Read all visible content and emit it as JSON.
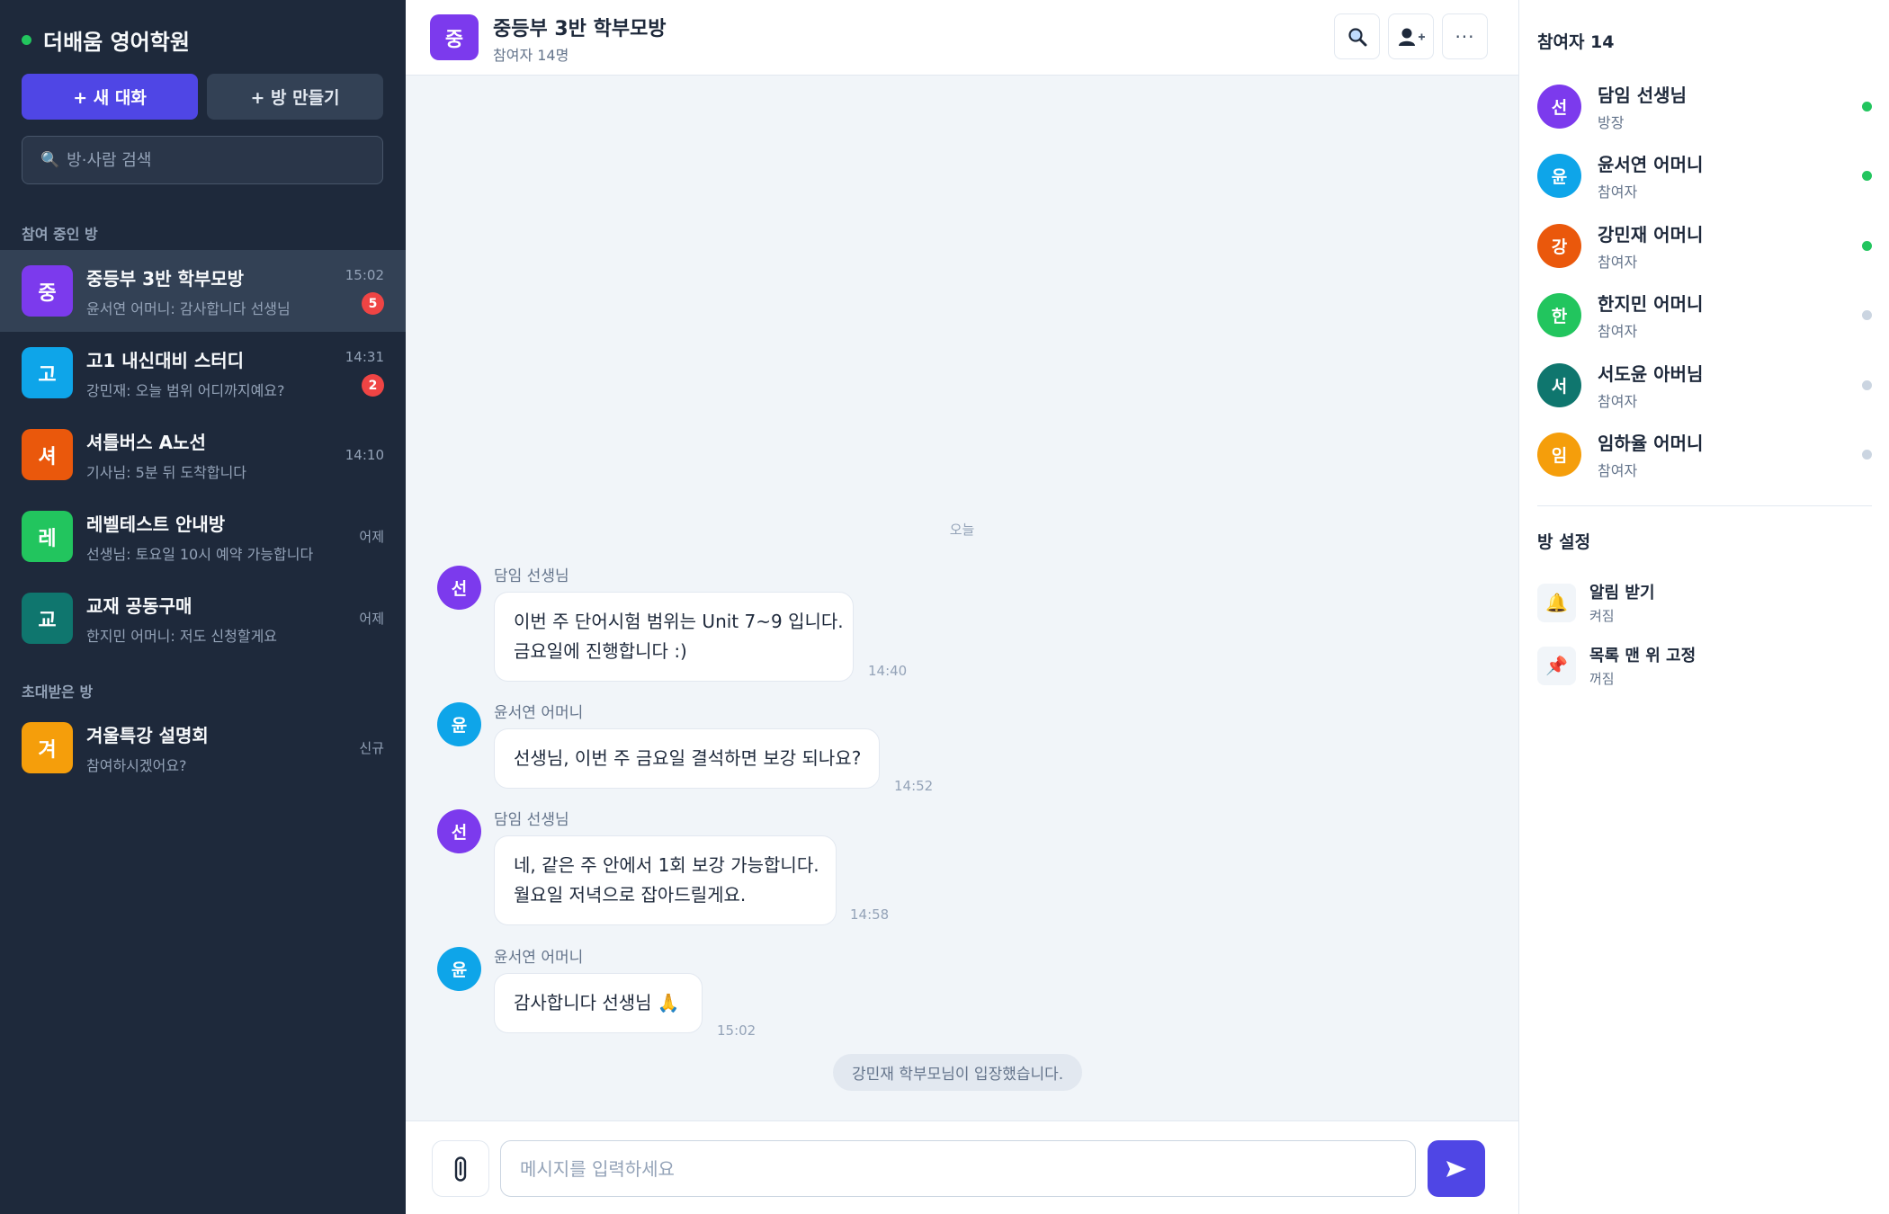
{
  "sidebar": {
    "brand": "더배움 영어학원",
    "new_chat_label": "+ 새 대화",
    "create_room_label": "+ 방 만들기",
    "search_placeholder": "방·사람 검색",
    "section_joined": "참여 중인 방",
    "section_invited": "초대받은 방",
    "joined_rooms": [
      {
        "avatar": "중",
        "color": "#7c3aed",
        "name": "중등부 3반 학부모방",
        "last": "윤서연 어머니: 감사합니다 선생님",
        "time": "15:02",
        "badge": "5",
        "active": true
      },
      {
        "avatar": "고",
        "color": "#0ea5e9",
        "name": "고1 내신대비 스터디",
        "last": "강민재: 오늘 범위 어디까지예요?",
        "time": "14:31",
        "badge": "2",
        "active": false
      },
      {
        "avatar": "셔",
        "color": "#ea580c",
        "name": "셔틀버스 A노선",
        "last": "기사님: 5분 뒤 도착합니다",
        "time": "14:10",
        "badge": "",
        "active": false
      },
      {
        "avatar": "레",
        "color": "#22c55e",
        "name": "레벨테스트 안내방",
        "last": "선생님: 토요일 10시 예약 가능합니다",
        "time": "어제",
        "badge": "",
        "active": false
      },
      {
        "avatar": "교",
        "color": "#0f766e",
        "name": "교재 공동구매",
        "last": "한지민 어머니: 저도 신청할게요",
        "time": "어제",
        "badge": "",
        "active": false
      }
    ],
    "invited_rooms": [
      {
        "avatar": "겨",
        "color": "#f59e0b",
        "name": "겨울특강 설명회",
        "last": "참여하시겠어요?",
        "time": "신규",
        "badge": "",
        "active": false
      }
    ]
  },
  "chat": {
    "avatar": "중",
    "title": "중등부 3반 학부모방",
    "subtitle": "참여자 14명",
    "header_icons": [
      "search-icon",
      "add-member-icon",
      "more-icon"
    ],
    "date_separator": "오늘",
    "messages": [
      {
        "avatar": "선",
        "color": "#7c3aed",
        "sender": "담임 선생님",
        "lines": [
          "이번 주 단어시험 범위는 Unit 7~9 입니다.",
          "금요일에 진행합니다 :)"
        ],
        "time": "14:40"
      },
      {
        "avatar": "윤",
        "color": "#0ea5e9",
        "sender": "윤서연 어머니",
        "lines": [
          "선생님, 이번 주 금요일 결석하면 보강 되나요?"
        ],
        "time": "14:52"
      },
      {
        "avatar": "선",
        "color": "#7c3aed",
        "sender": "담임 선생님",
        "lines": [
          "네, 같은 주 안에서 1회 보강 가능합니다.",
          "월요일 저녁으로 잡아드릴게요."
        ],
        "time": "14:58"
      },
      {
        "avatar": "윤",
        "color": "#0ea5e9",
        "sender": "윤서연 어머니",
        "lines": [
          "감사합니다 선생님 🙏"
        ],
        "time": "15:02"
      }
    ],
    "system_message": "강민재 학부모님이 입장했습니다.",
    "composer_placeholder": "메시지를 입력하세요"
  },
  "right_panel": {
    "participants_title": "참여자 14",
    "members": [
      {
        "avatar": "선",
        "color": "#7c3aed",
        "name": "담임 선생님",
        "role": "방장",
        "online": true
      },
      {
        "avatar": "윤",
        "color": "#0ea5e9",
        "name": "윤서연 어머니",
        "role": "참여자",
        "online": true
      },
      {
        "avatar": "강",
        "color": "#ea580c",
        "name": "강민재 어머니",
        "role": "참여자",
        "online": true
      },
      {
        "avatar": "한",
        "color": "#22c55e",
        "name": "한지민 어머니",
        "role": "참여자",
        "online": false
      },
      {
        "avatar": "서",
        "color": "#0f766e",
        "name": "서도윤 아버님",
        "role": "참여자",
        "online": false
      },
      {
        "avatar": "임",
        "color": "#f59e0b",
        "name": "임하율 어머니",
        "role": "참여자",
        "online": false
      }
    ],
    "settings_title": "방 설정",
    "settings": [
      {
        "icon": "🔔",
        "icon_name": "bell-icon",
        "name": "알림 받기",
        "value": "켜짐"
      },
      {
        "icon": "📌",
        "icon_name": "pin-icon",
        "name": "목록 맨 위 고정",
        "value": "꺼짐"
      }
    ]
  },
  "colors": {
    "accent": "#4f46e5",
    "online": "#22c55e",
    "offline": "#cbd5e1",
    "unread_badge": "#ef4444"
  }
}
